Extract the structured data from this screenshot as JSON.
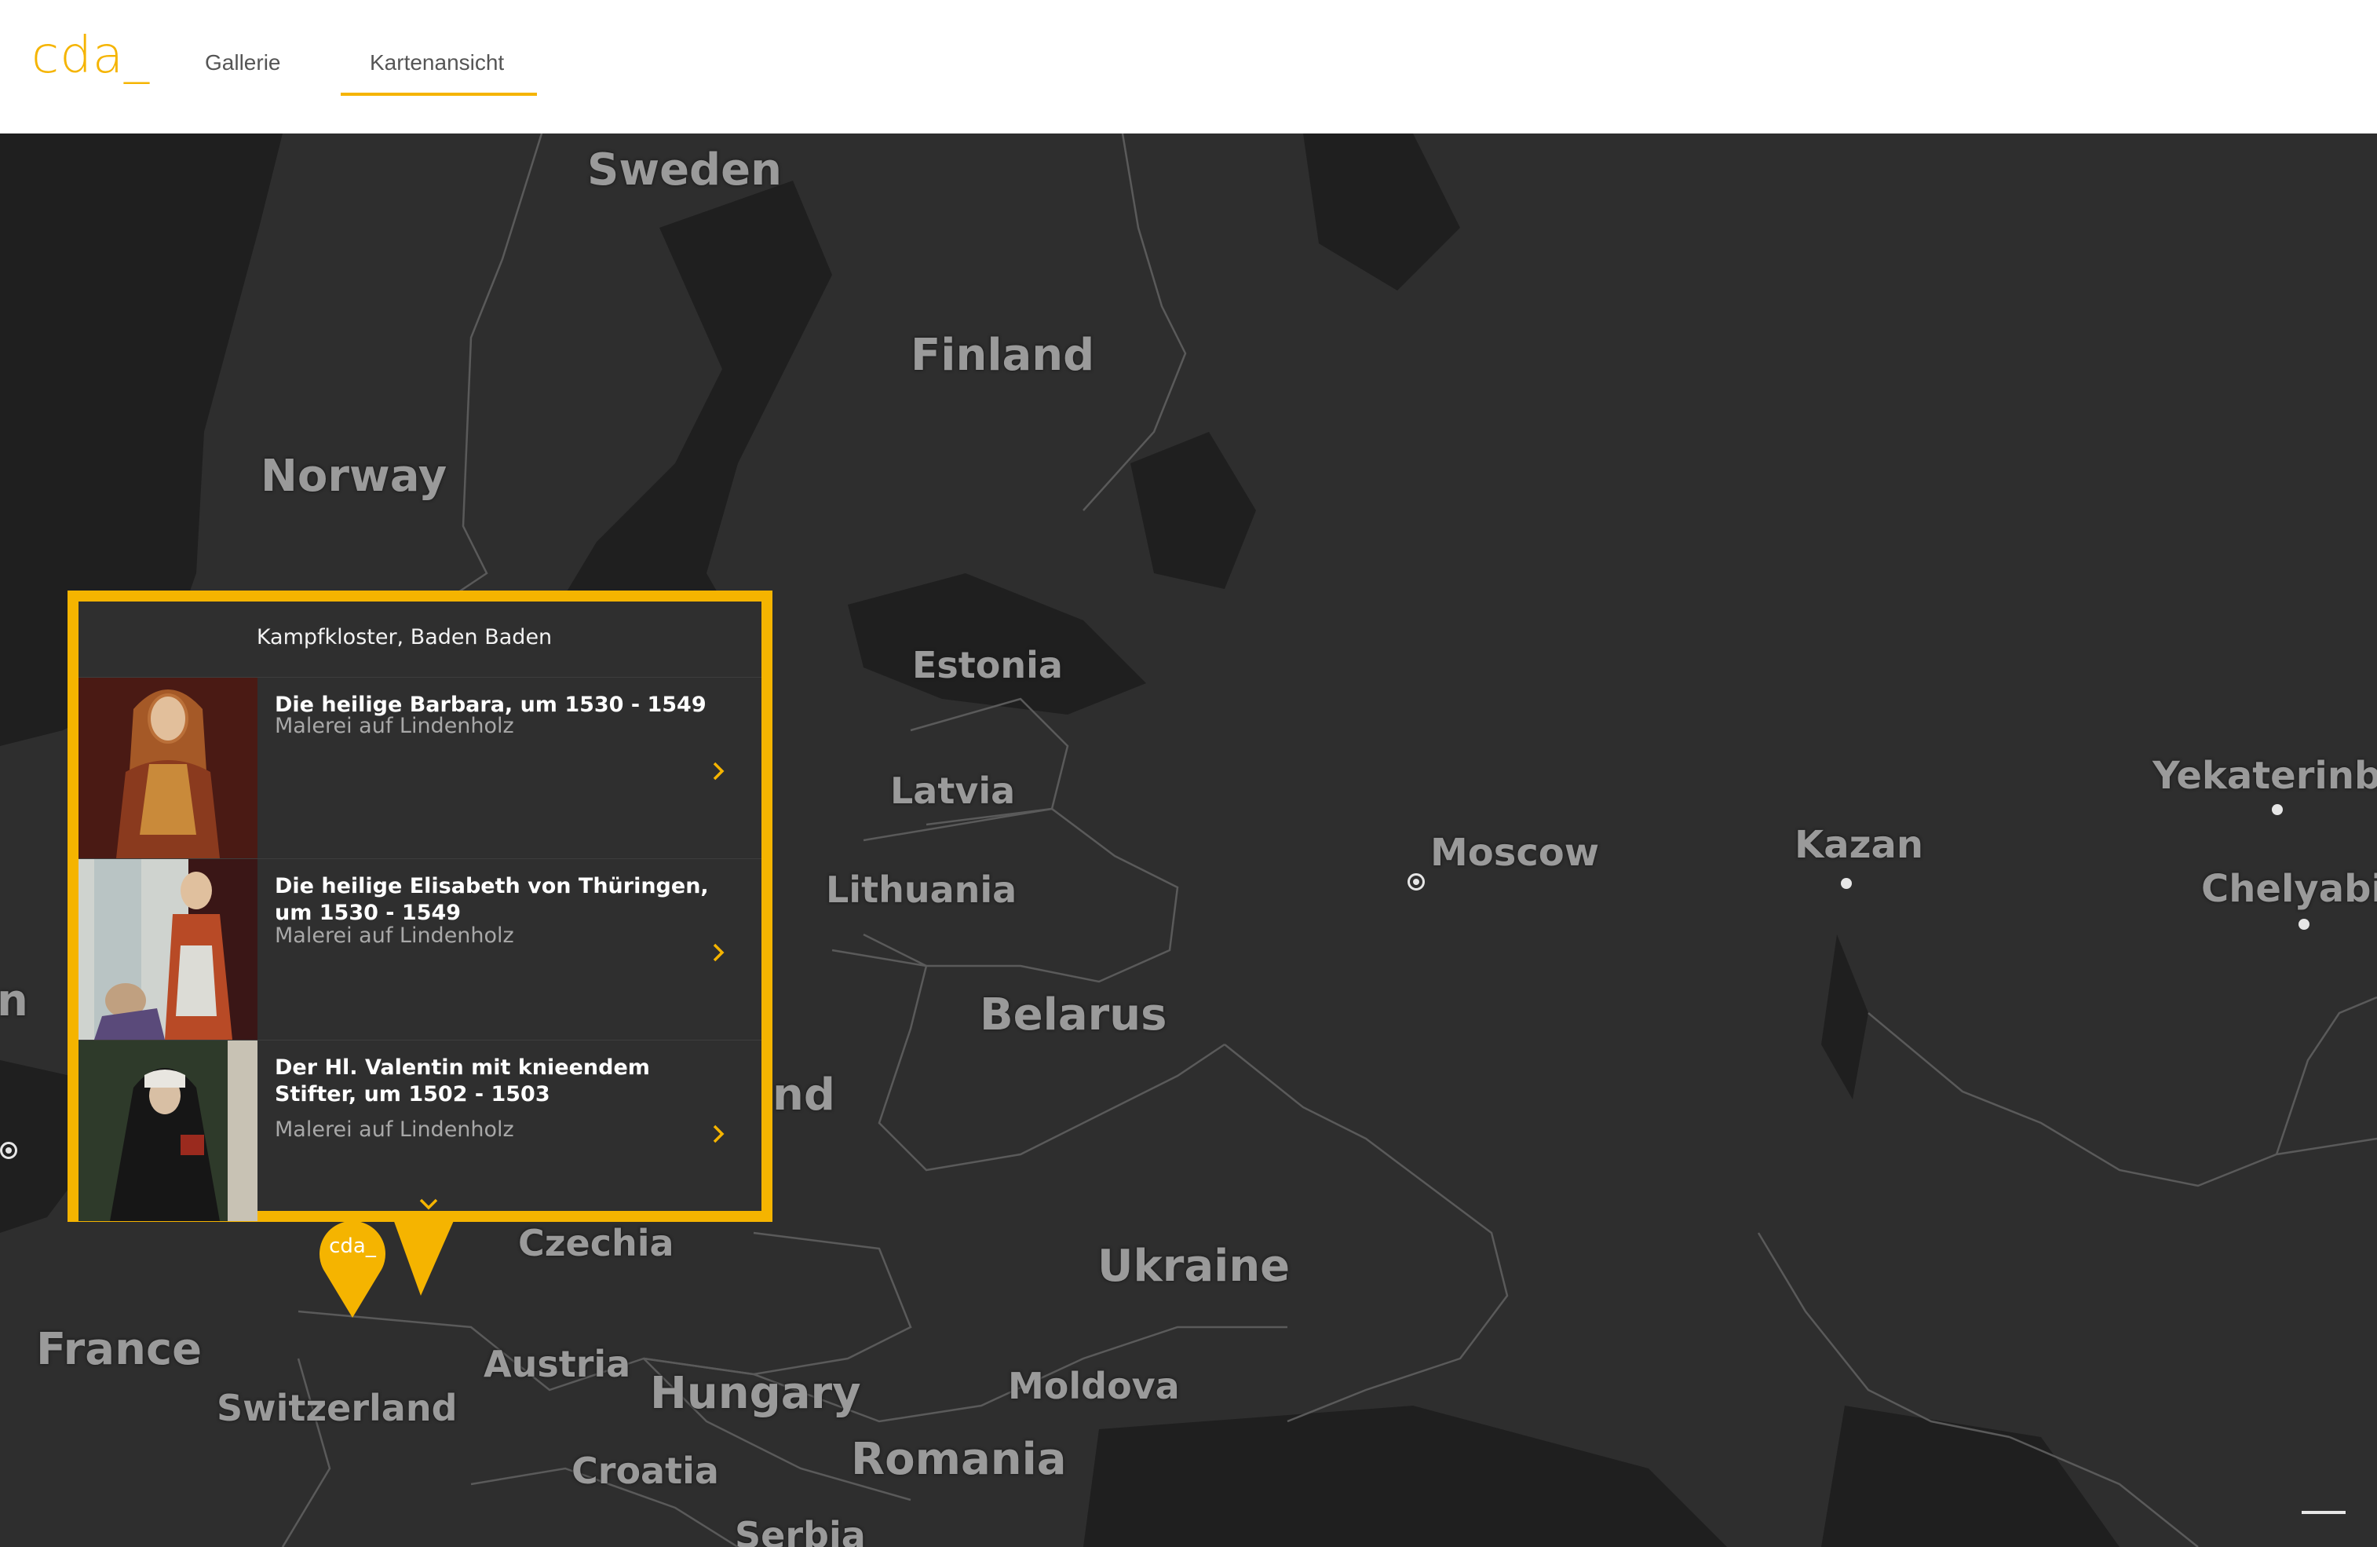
{
  "header": {
    "logo": "cda_",
    "nav": [
      {
        "label": "Gallerie",
        "active": false
      },
      {
        "label": "Kartenansicht",
        "active": true
      }
    ]
  },
  "map": {
    "countries": [
      "Sweden",
      "Finland",
      "Norway",
      "Estonia",
      "Latvia",
      "Lithuania",
      "Belarus",
      "Czechia",
      "Ukraine",
      "France",
      "Switzerland",
      "Austria",
      "Hungary",
      "Moldova",
      "Romania",
      "Croatia",
      "Serbia"
    ],
    "partial_labels": [
      "nd",
      "n"
    ],
    "cities": [
      "Moscow",
      "Kazan",
      "Yekaterinbur",
      "Chelyabins"
    ]
  },
  "popup": {
    "location": "Kampfkloster, Baden Baden",
    "items": [
      {
        "title": "Die heilige Barbara, um 1530 - 1549",
        "subtitle": "Malerei auf Lindenholz"
      },
      {
        "title": "Die heilige Elisabeth von Thüringen, um 1530 - 1549",
        "subtitle": "Malerei auf Lindenholz"
      },
      {
        "title": "Der Hl. Valentin mit knieendem Stifter, um 1502 - 1503",
        "subtitle": "Malerei auf Lindenholz"
      }
    ]
  },
  "marker": {
    "label": "cda_"
  },
  "colors": {
    "accent": "#f5b400",
    "map_land": "#2e2e2e",
    "map_water": "#1f1f1f"
  }
}
